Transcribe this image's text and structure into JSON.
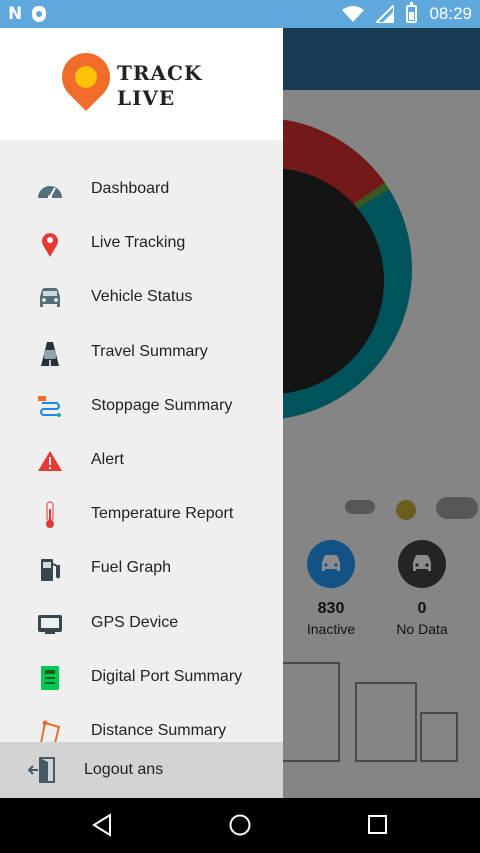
{
  "status_bar": {
    "time": "08:29",
    "icons": [
      "n-icon",
      "shield-icon",
      "wifi-icon",
      "signal-icon",
      "battery-icon"
    ]
  },
  "background": {
    "stats": [
      {
        "value": "830",
        "label": "Inactive",
        "color": "#2196f3"
      },
      {
        "value": "0",
        "label": "No Data",
        "color": "#424242"
      }
    ]
  },
  "drawer": {
    "brand": {
      "line1": "TRACK",
      "line2": "LIVE"
    },
    "items": [
      {
        "label": "Dashboard",
        "icon": "speedometer-icon"
      },
      {
        "label": "Live Tracking",
        "icon": "location-pin-icon"
      },
      {
        "label": "Vehicle Status",
        "icon": "car-icon"
      },
      {
        "label": "Travel Summary",
        "icon": "road-car-icon"
      },
      {
        "label": "Stoppage Summary",
        "icon": "route-icon"
      },
      {
        "label": "Alert",
        "icon": "warning-icon"
      },
      {
        "label": "Temperature Report",
        "icon": "thermometer-icon"
      },
      {
        "label": "Fuel Graph",
        "icon": "fuel-pump-icon"
      },
      {
        "label": "GPS Device",
        "icon": "gps-device-icon"
      },
      {
        "label": "Digital Port Summary",
        "icon": "digital-port-icon"
      },
      {
        "label": "Distance Summary",
        "icon": "distance-icon"
      }
    ],
    "logout": {
      "label": "Logout ans",
      "icon": "logout-icon"
    }
  },
  "colors": {
    "status_bar": "#5ea8dc",
    "header": "#2f6e99",
    "logo_orange": "#ef6c2b",
    "alert_red": "#e53935"
  }
}
